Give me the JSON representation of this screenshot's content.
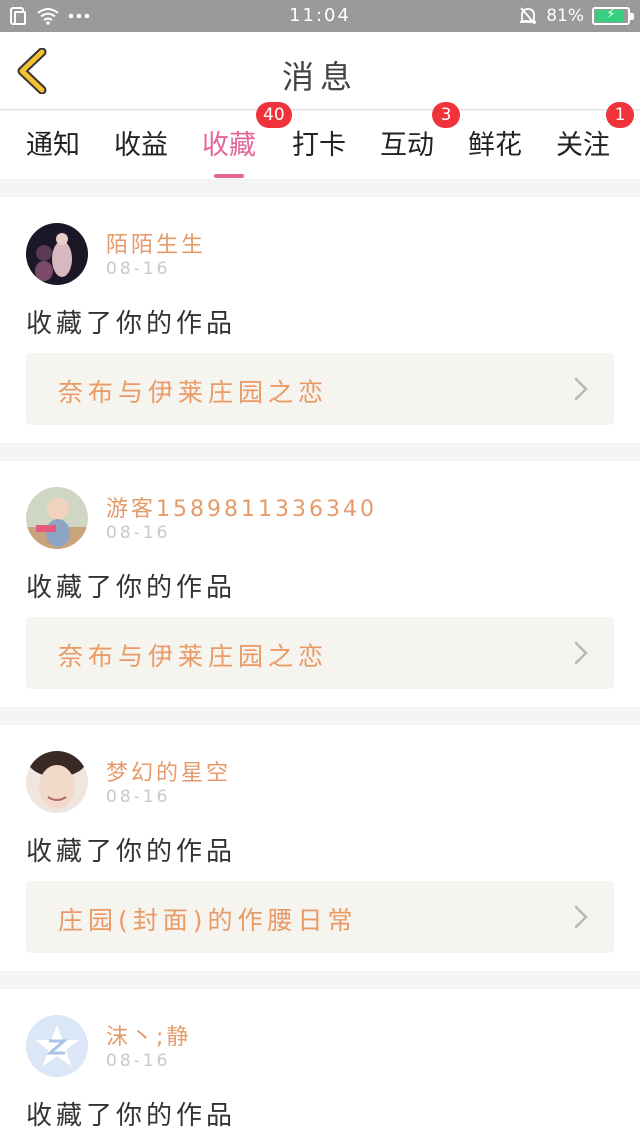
{
  "status_bar": {
    "time": "11:04",
    "battery": "81%",
    "battery_level": 0.81
  },
  "header": {
    "title": "消息",
    "back_icon": "chevron-left-icon"
  },
  "tabs": [
    {
      "label": "通知"
    },
    {
      "label": "收益"
    },
    {
      "label": "收藏",
      "badge": "40",
      "active": true
    },
    {
      "label": "打卡"
    },
    {
      "label": "互动",
      "badge": "3"
    },
    {
      "label": "鲜花"
    },
    {
      "label": "关注",
      "badge": "1"
    }
  ],
  "messages": [
    {
      "user": "陌陌生生",
      "date": "08-16",
      "action": "收藏了你的作品",
      "work": "奈布与伊莱庄园之恋"
    },
    {
      "user": "游客1589811336340",
      "date": "08-16",
      "action": "收藏了你的作品",
      "work": "奈布与伊莱庄园之恋"
    },
    {
      "user": "梦幻的星空",
      "date": "08-16",
      "action": "收藏了你的作品",
      "work": "庄园(封面)的作腰日常"
    },
    {
      "user": "沫丶;静",
      "date": "08-16",
      "action": "收藏了你的作品"
    }
  ],
  "colors": {
    "accent": "#e4679a",
    "badge": "#f0323a",
    "username": "#e59a6a",
    "back_arrow": "#f2c230"
  }
}
